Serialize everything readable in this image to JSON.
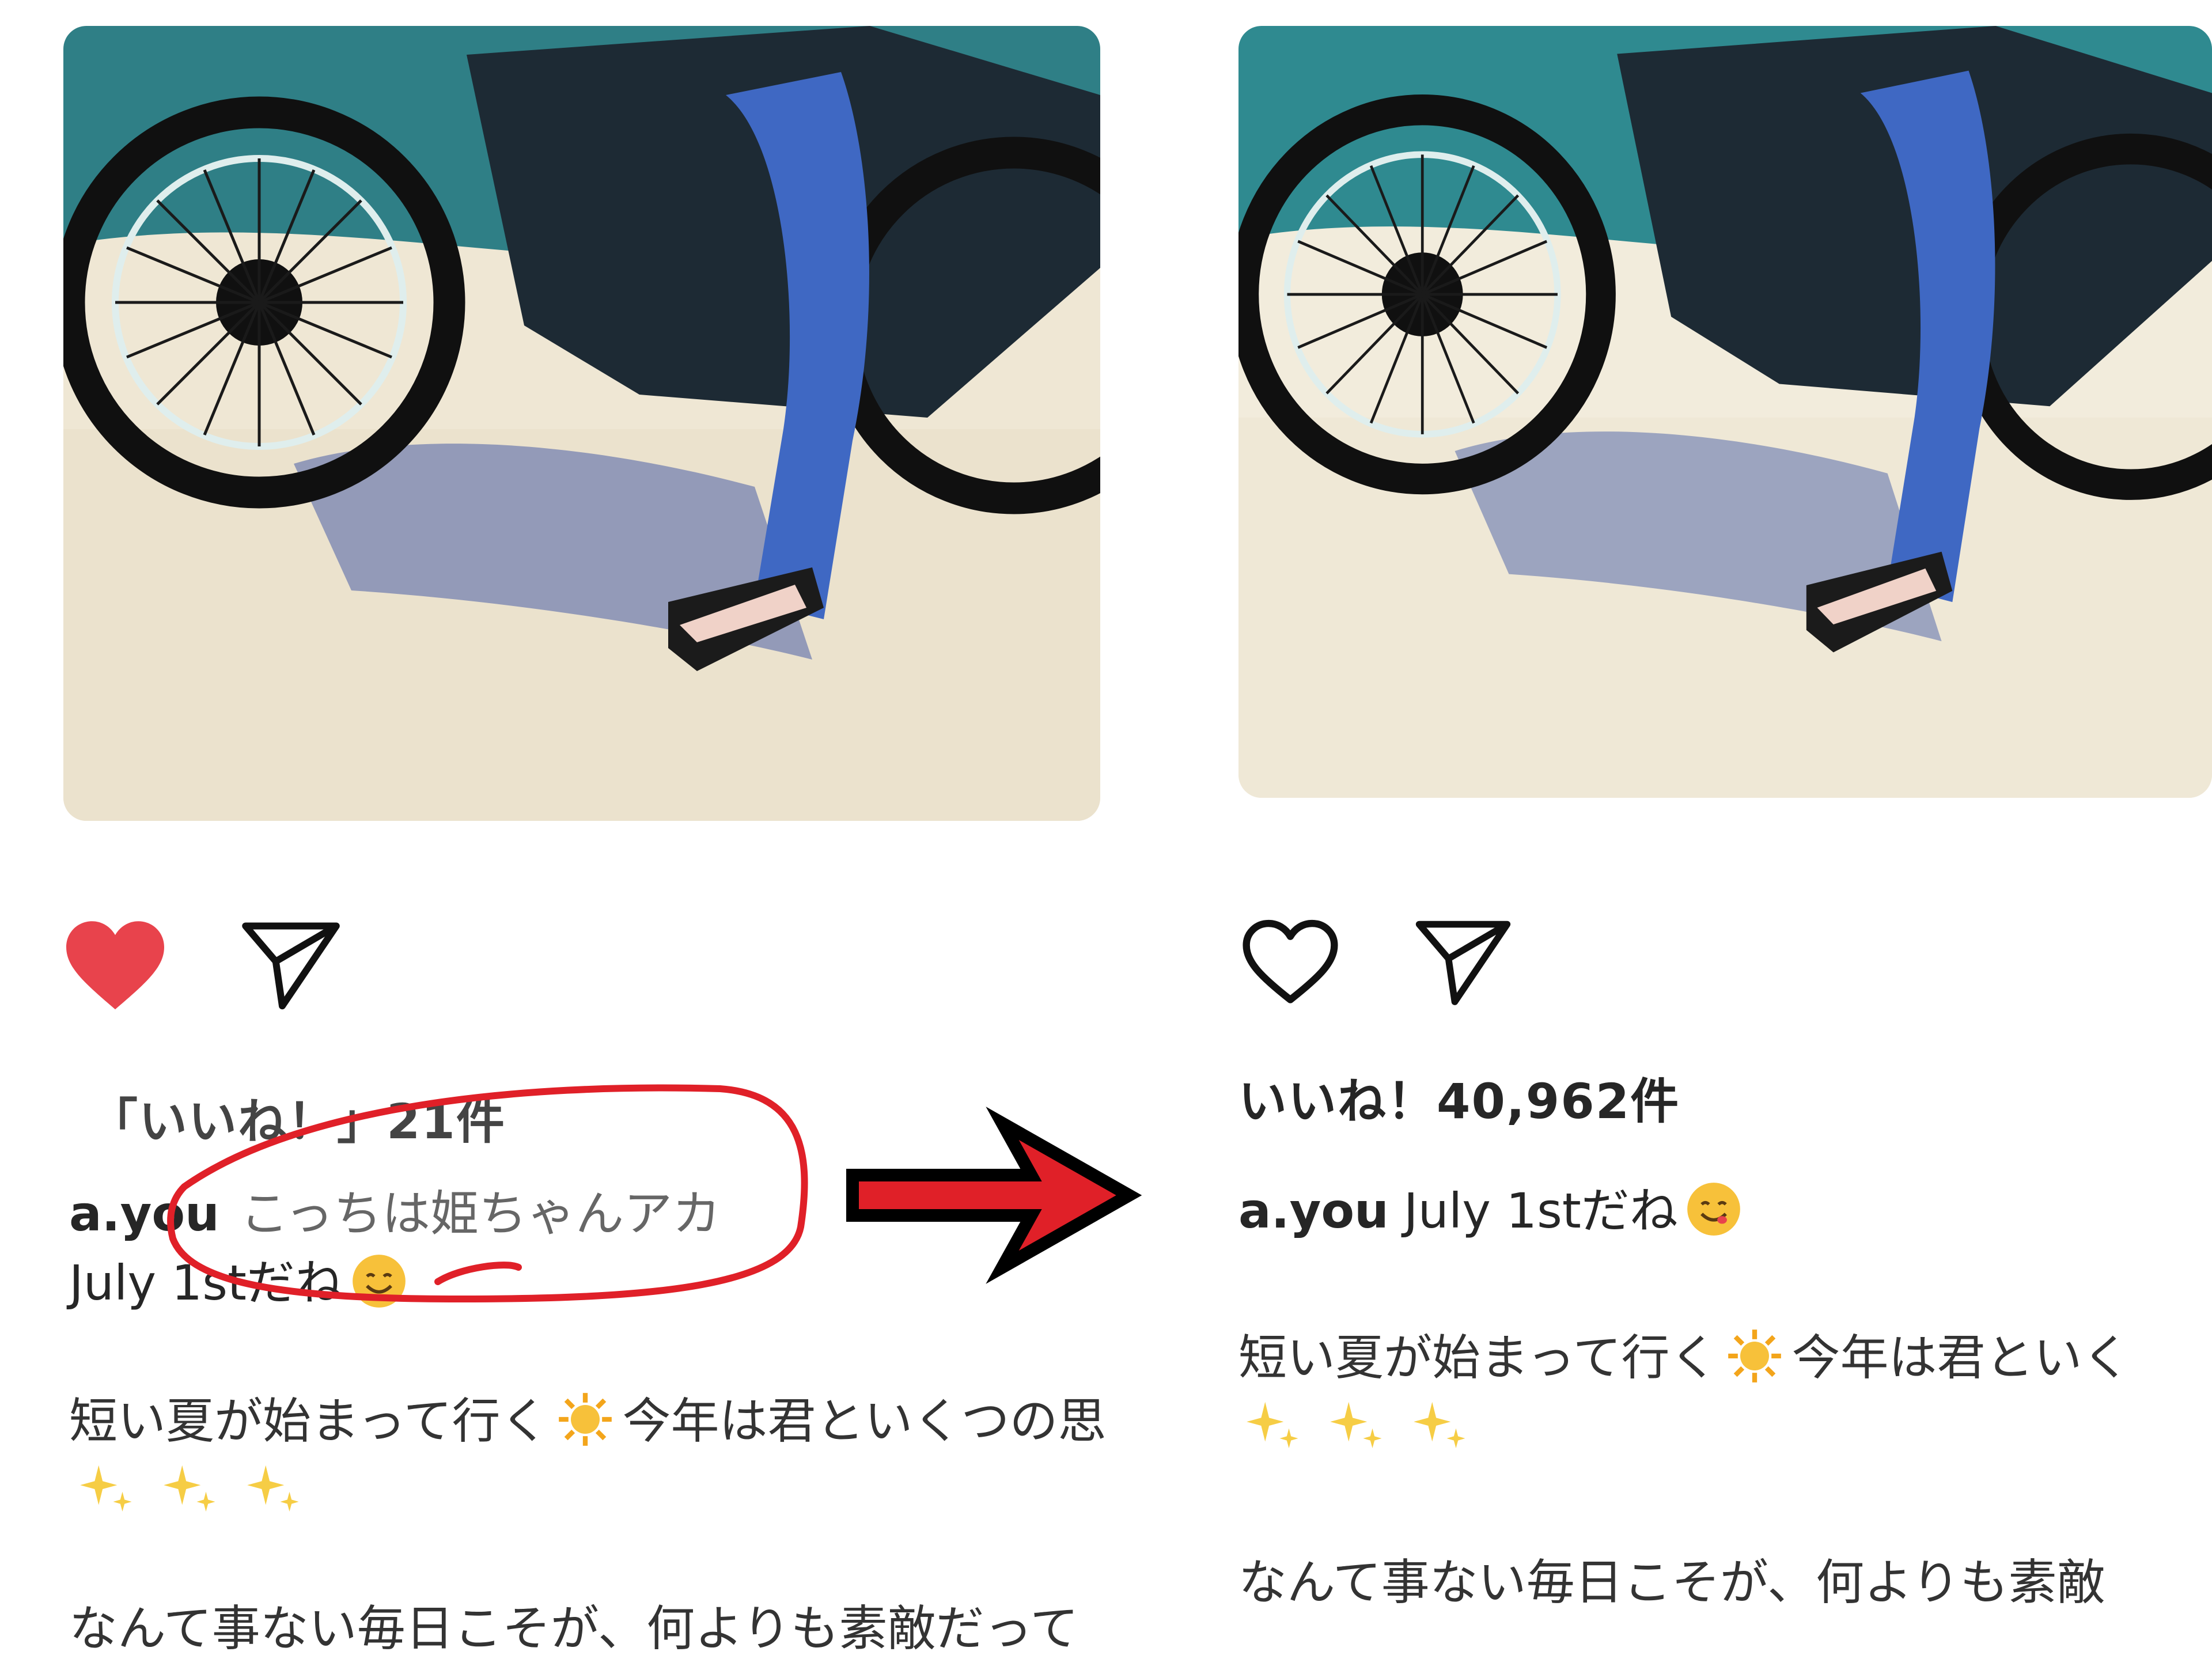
{
  "left_post": {
    "likes_text": "「いいね！」21件",
    "username": "a.you",
    "caption_line1": "こっちは姫ちゃんアカ",
    "caption_line2": "July 1stだね",
    "body_line1_a": "短い夏が始まって行く",
    "body_line1_b": "今年は君といくつの思",
    "body_line2": "なんて事ない毎日こそが、何よりも素敵だって",
    "liked": true
  },
  "right_post": {
    "likes_text": "いいね！40,962件",
    "username": "a.you",
    "caption_line1": "July 1stだね",
    "body_line1_a": "短い夏が始まって行く",
    "body_line1_b": "今年は君といく",
    "body_line2": "なんて事ない毎日こそが、何よりも素敵",
    "liked": false
  },
  "icons": {
    "like_filled": "heart-filled-icon",
    "like_outline": "heart-outline-icon",
    "share": "paper-plane-icon",
    "sun": "sun-emoji",
    "smile": "smiling-face-emoji",
    "sparkles": "sparkles-emoji",
    "arrow": "right-arrow"
  },
  "colors": {
    "heart_red": "#e8434c",
    "annotation_red": "#e02028",
    "text": "#262626",
    "arrow_outline": "#000000"
  }
}
